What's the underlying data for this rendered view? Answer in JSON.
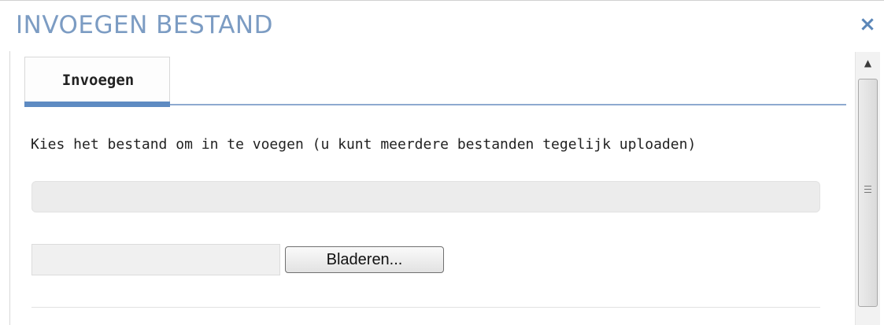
{
  "dialog": {
    "title": "INVOEGEN BESTAND",
    "close_symbol": "×"
  },
  "tabs": [
    {
      "label": "Invoegen",
      "active": true
    }
  ],
  "upload": {
    "instruction": "Kies het bestand om in te voegen (u kunt meerdere bestanden tegelijk uploaden)",
    "file_path_value": "",
    "browse_label": "Bladeren..."
  },
  "scrollbar": {
    "up_symbol": "▲"
  },
  "colors": {
    "title": "#7c9cc3",
    "close": "#5a86b8",
    "tab_accent": "#5e8bc2",
    "tab_rule": "#8eaad0"
  }
}
